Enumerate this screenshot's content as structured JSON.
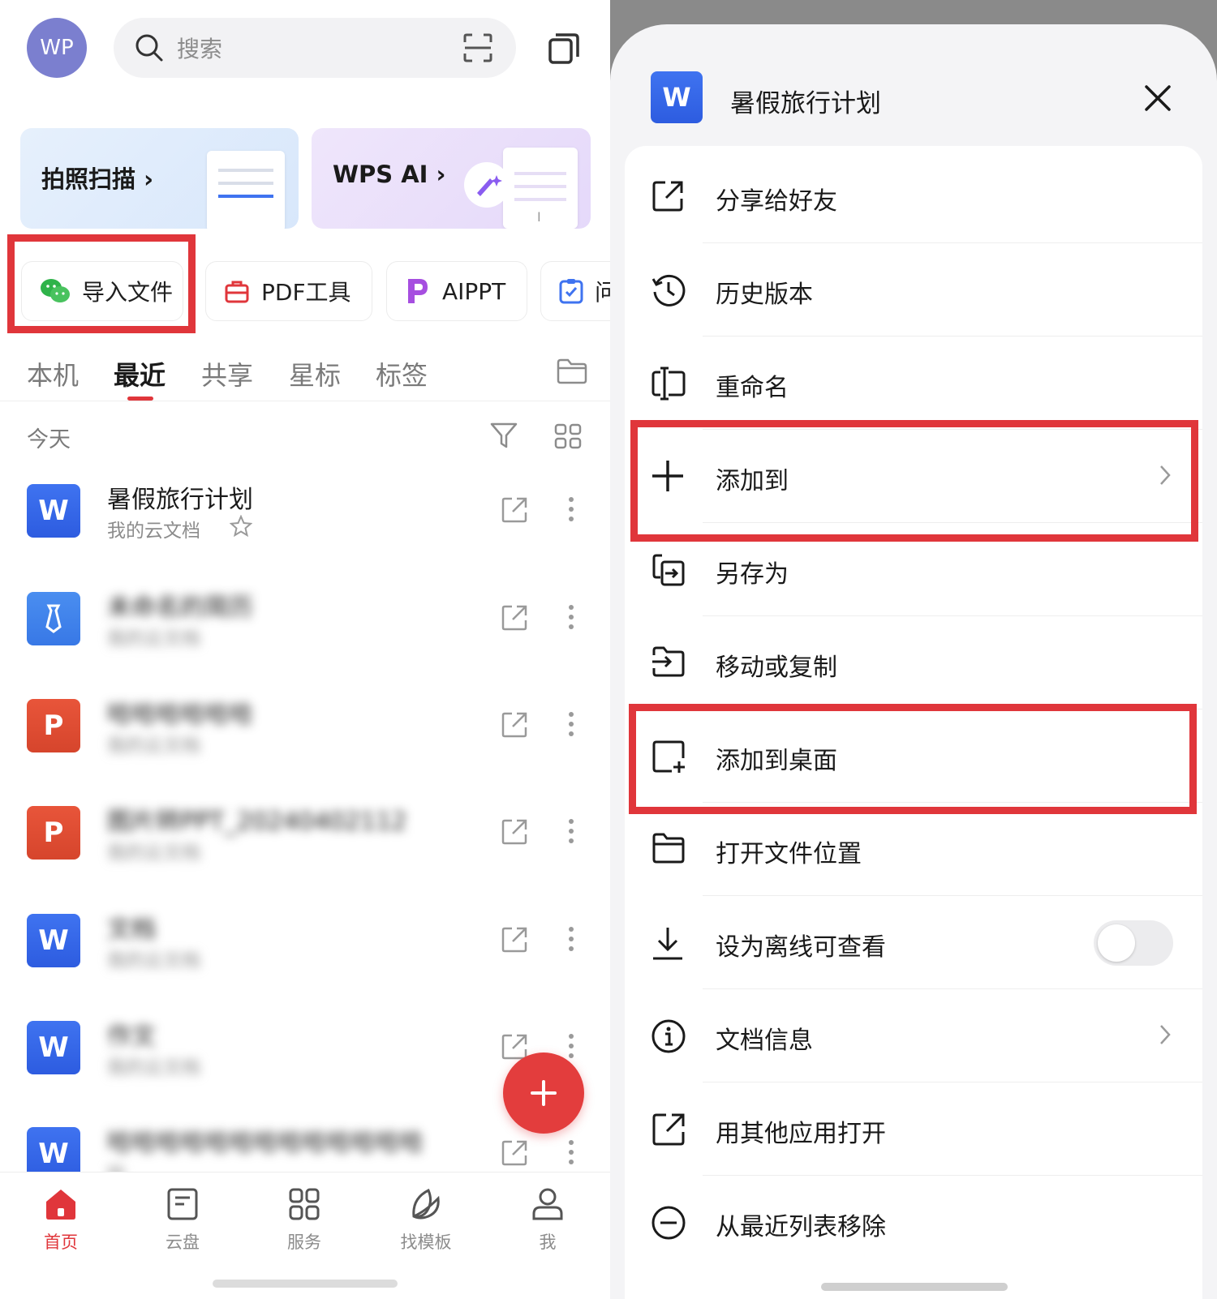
{
  "left": {
    "avatar": "WP",
    "search_placeholder": "搜索",
    "banners": {
      "scan": "拍照扫描 ›",
      "ai": "WPS AI ›",
      "ai_cursor": "I"
    },
    "chips": {
      "import": "导入文件",
      "pdf": "PDF工具",
      "aippt": "AIPPT",
      "partial": "问"
    },
    "tabs": [
      "本机",
      "最近",
      "共享",
      "星标",
      "标签"
    ],
    "section": "今天",
    "files": [
      {
        "icon": "W",
        "title": "暑假旅行计划",
        "subtitle": "我的云文档"
      },
      {
        "icon": "简",
        "title": "未命名的简历",
        "subtitle": "我的云文档"
      },
      {
        "icon": "P",
        "title": "哈哈哈哈哈哈",
        "subtitle": "我的云文档"
      },
      {
        "icon": "P",
        "title": "图片转PPT_20240402112",
        "subtitle": "我的云文档"
      },
      {
        "icon": "W",
        "title": "文档",
        "subtitle": "我的云文档"
      },
      {
        "icon": "W",
        "title": "作文",
        "subtitle": "我的云文档"
      },
      {
        "icon": "W",
        "title": "哈哈哈哈哈哈哈哈哈哈哈哈哈",
        "subtitle": "哈"
      }
    ],
    "nav": [
      "首页",
      "云盘",
      "服务",
      "找模板",
      "我"
    ]
  },
  "right": {
    "doc_icon": "W",
    "doc_title": "暑假旅行计划",
    "menu": [
      "分享给好友",
      "历史版本",
      "重命名",
      "添加到",
      "另存为",
      "移动或复制",
      "添加到桌面",
      "打开文件位置",
      "设为离线可查看",
      "文档信息",
      "用其他应用打开",
      "从最近列表移除"
    ]
  },
  "colors": {
    "accent_red": "#e0363b",
    "word_blue": "#2d5ce0",
    "ppt_orange": "#d6452c",
    "avatar_purple": "#7b7fcf"
  }
}
